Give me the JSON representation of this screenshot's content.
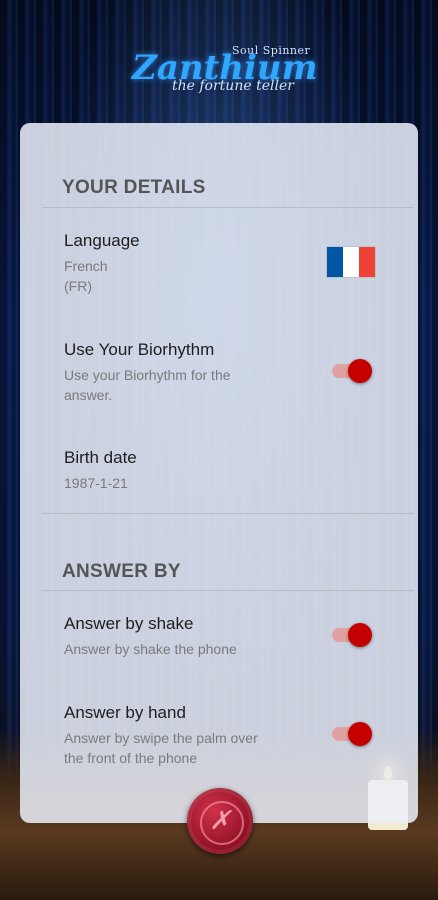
{
  "brand": {
    "tagline_top": "Soul Spinner",
    "name": "Zanthium",
    "subtitle": "the fortune teller"
  },
  "details": {
    "header": "YOUR DETAILS",
    "language": {
      "title": "Language",
      "value_line1": "French",
      "value_line2": "(FR)",
      "flag_colors": [
        "#0055a4",
        "#ffffff",
        "#ef4135"
      ]
    },
    "biorhythm": {
      "title": "Use Your Biorhythm",
      "sub_line1": "Use your Biorhythm for the",
      "sub_line2": "answer.",
      "enabled": true
    },
    "birth": {
      "title": "Birth date",
      "value": "1987-1-21"
    }
  },
  "answer_by": {
    "header": "ANSWER BY",
    "shake": {
      "title": "Answer by shake",
      "sub": "Answer by shake the phone",
      "enabled": true
    },
    "hand": {
      "title": "Answer by hand",
      "sub_line1": "Answer by swipe the palm over",
      "sub_line2": "the front of the phone",
      "enabled": true
    }
  },
  "colors": {
    "toggle_on": "#c40000",
    "toggle_track": "#e2a1a1",
    "seal": "#a8182e"
  },
  "close_seal": {
    "icon": "close-x-icon"
  }
}
